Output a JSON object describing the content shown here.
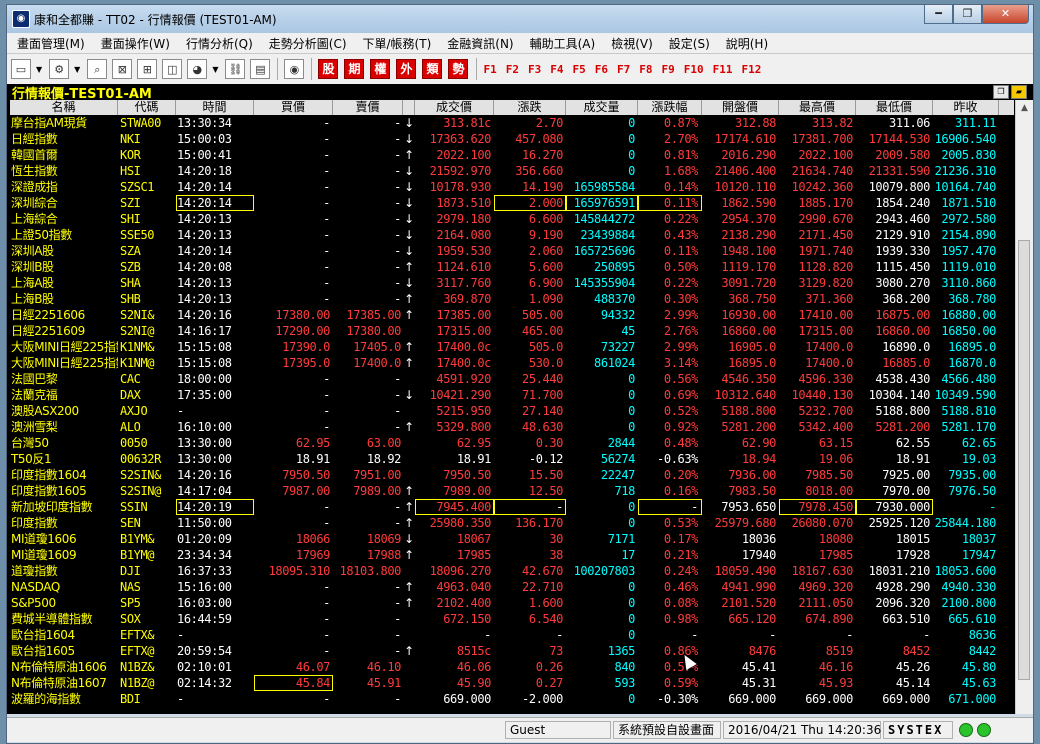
{
  "window": {
    "title": "康和全都賺 - TT02 - 行情報價 (TEST01-AM)",
    "minimize": "━",
    "maximize": "❐",
    "close": "✕"
  },
  "menu": [
    "畫面管理(M)",
    "畫面操作(W)",
    "行情分析(Q)",
    "走勢分析圖(C)",
    "下單/帳務(T)",
    "金融資訊(N)",
    "輔助工具(A)",
    "檢視(V)",
    "設定(S)",
    "說明(H)"
  ],
  "toolbar": {
    "icons": [
      "window-icon",
      "gear-icon",
      "search-icon",
      "close-box-icon",
      "grid-icon",
      "layout-icon",
      "palette-icon",
      "link-icon",
      "chart-icon",
      "logo-icon"
    ],
    "red_buttons": [
      "股",
      "期",
      "權",
      "外",
      "類",
      "勢"
    ],
    "fkeys": [
      "F1",
      "F2",
      "F3",
      "F4",
      "F5",
      "F6",
      "F7",
      "F8",
      "F9",
      "F10",
      "F11",
      "F12"
    ]
  },
  "panel": {
    "title": "行情報價-TEST01-AM"
  },
  "columns": [
    "名稱",
    "代碼",
    "時間",
    "買價",
    "賣價",
    "",
    "成交價",
    "漲跌",
    "成交量",
    "漲跌幅",
    "開盤價",
    "最高價",
    "最低價",
    "昨收"
  ],
  "rows": [
    {
      "name": "摩台指AM現貨",
      "code": "STWA00",
      "time": "13:30:34",
      "bid": "-",
      "ask": "-",
      "arr": "↓",
      "last": "313.81c",
      "chg": "2.70",
      "vol": "0",
      "pct": "0.87%",
      "open": "312.88",
      "high": "313.82",
      "low": "311.06",
      "prev": "311.11"
    },
    {
      "name": "日經指數",
      "code": "NKI",
      "time": "15:00:03",
      "bid": "-",
      "ask": "-",
      "arr": "↓",
      "last": "17363.620",
      "chg": "457.080",
      "vol": "0",
      "pct": "2.70%",
      "open": "17174.610",
      "high": "17381.700",
      "low": "17144.530",
      "prev": "16906.540"
    },
    {
      "name": "韓國首爾",
      "code": "KOR",
      "time": "15:00:41",
      "bid": "-",
      "ask": "-",
      "arr": "↑",
      "last": "2022.100",
      "chg": "16.270",
      "vol": "0",
      "pct": "0.81%",
      "open": "2016.290",
      "high": "2022.100",
      "low": "2009.580",
      "prev": "2005.830"
    },
    {
      "name": "恆生指數",
      "code": "HSI",
      "time": "14:20:18",
      "bid": "-",
      "ask": "-",
      "arr": "↓",
      "last": "21592.970",
      "chg": "356.660",
      "vol": "0",
      "pct": "1.68%",
      "open": "21406.400",
      "high": "21634.740",
      "low": "21331.590",
      "prev": "21236.310"
    },
    {
      "name": "深證成指",
      "code": "SZSC1",
      "time": "14:20:14",
      "bid": "-",
      "ask": "-",
      "arr": "↓",
      "last": "10178.930",
      "chg": "14.190",
      "vol": "165985584",
      "pct": "0.14%",
      "open": "10120.110",
      "high": "10242.360",
      "low": "10079.800",
      "prev": "10164.740"
    },
    {
      "name": "深圳綜合",
      "code": "SZI",
      "time": "14:20:14",
      "bid": "-",
      "ask": "-",
      "arr": "↓",
      "last": "1873.510",
      "chg": "2.000",
      "vol": "165976591",
      "pct": "0.11%",
      "open": "1862.590",
      "high": "1885.170",
      "low": "1854.240",
      "prev": "1871.510"
    },
    {
      "name": "上海綜合",
      "code": "SHI",
      "time": "14:20:13",
      "bid": "-",
      "ask": "-",
      "arr": "↓",
      "last": "2979.180",
      "chg": "6.600",
      "vol": "145844272",
      "pct": "0.22%",
      "open": "2954.370",
      "high": "2990.670",
      "low": "2943.460",
      "prev": "2972.580"
    },
    {
      "name": "上證50指數",
      "code": "SSE50",
      "time": "14:20:13",
      "bid": "-",
      "ask": "-",
      "arr": "↓",
      "last": "2164.080",
      "chg": "9.190",
      "vol": "23439884",
      "pct": "0.43%",
      "open": "2138.290",
      "high": "2171.450",
      "low": "2129.910",
      "prev": "2154.890"
    },
    {
      "name": "深圳A股",
      "code": "SZA",
      "time": "14:20:14",
      "bid": "-",
      "ask": "-",
      "arr": "↓",
      "last": "1959.530",
      "chg": "2.060",
      "vol": "165725696",
      "pct": "0.11%",
      "open": "1948.100",
      "high": "1971.740",
      "low": "1939.330",
      "prev": "1957.470"
    },
    {
      "name": "深圳B股",
      "code": "SZB",
      "time": "14:20:08",
      "bid": "-",
      "ask": "-",
      "arr": "↑",
      "last": "1124.610",
      "chg": "5.600",
      "vol": "250895",
      "pct": "0.50%",
      "open": "1119.170",
      "high": "1128.820",
      "low": "1115.450",
      "prev": "1119.010"
    },
    {
      "name": "上海A股",
      "code": "SHA",
      "time": "14:20:13",
      "bid": "-",
      "ask": "-",
      "arr": "↓",
      "last": "3117.760",
      "chg": "6.900",
      "vol": "145355904",
      "pct": "0.22%",
      "open": "3091.720",
      "high": "3129.820",
      "low": "3080.270",
      "prev": "3110.860"
    },
    {
      "name": "上海B股",
      "code": "SHB",
      "time": "14:20:13",
      "bid": "-",
      "ask": "-",
      "arr": "↑",
      "last": "369.870",
      "chg": "1.090",
      "vol": "488370",
      "pct": "0.30%",
      "open": "368.750",
      "high": "371.360",
      "low": "368.200",
      "prev": "368.780"
    },
    {
      "name": "日經2251606",
      "code": "S2NI&",
      "time": "14:20:16",
      "bid": "17380.00",
      "ask": "17385.00",
      "arr": "↑",
      "last": "17385.00",
      "chg": "505.00",
      "vol": "94332",
      "pct": "2.99%",
      "open": "16930.00",
      "high": "17410.00",
      "low": "16875.00",
      "prev": "16880.00"
    },
    {
      "name": "日經2251609",
      "code": "S2NI@",
      "time": "14:16:17",
      "bid": "17290.00",
      "ask": "17380.00",
      "arr": "",
      "last": "17315.00",
      "chg": "465.00",
      "vol": "45",
      "pct": "2.76%",
      "open": "16860.00",
      "high": "17315.00",
      "low": "16860.00",
      "prev": "16850.00"
    },
    {
      "name": "大阪MINI日經225指數",
      "code": "K1NM&",
      "time": "15:15:08",
      "bid": "17390.0",
      "ask": "17405.0",
      "arr": "↑",
      "last": "17400.0c",
      "chg": "505.0",
      "vol": "73227",
      "pct": "2.99%",
      "open": "16905.0",
      "high": "17400.0",
      "low": "16890.0",
      "prev": "16895.0"
    },
    {
      "name": "大阪MINI日經225指數",
      "code": "K1NM@",
      "time": "15:15:08",
      "bid": "17395.0",
      "ask": "17400.0",
      "arr": "↑",
      "last": "17400.0c",
      "chg": "530.0",
      "vol": "861024",
      "pct": "3.14%",
      "open": "16895.0",
      "high": "17400.0",
      "low": "16885.0",
      "prev": "16870.0"
    },
    {
      "name": "法國巴黎",
      "code": "CAC",
      "time": "18:00:00",
      "bid": "-",
      "ask": "-",
      "arr": "",
      "last": "4591.920",
      "chg": "25.440",
      "vol": "0",
      "pct": "0.56%",
      "open": "4546.350",
      "high": "4596.330",
      "low": "4538.430",
      "prev": "4566.480"
    },
    {
      "name": "法蘭克福",
      "code": "DAX",
      "time": "17:35:00",
      "bid": "-",
      "ask": "-",
      "arr": "↓",
      "last": "10421.290",
      "chg": "71.700",
      "vol": "0",
      "pct": "0.69%",
      "open": "10312.640",
      "high": "10440.130",
      "low": "10304.140",
      "prev": "10349.590"
    },
    {
      "name": "澳股ASX200",
      "code": "AXJO",
      "time": "-",
      "bid": "-",
      "ask": "-",
      "arr": "",
      "last": "5215.950",
      "chg": "27.140",
      "vol": "0",
      "pct": "0.52%",
      "open": "5188.800",
      "high": "5232.700",
      "low": "5188.800",
      "prev": "5188.810"
    },
    {
      "name": "澳洲雪梨",
      "code": "ALO",
      "time": "16:10:00",
      "bid": "-",
      "ask": "-",
      "arr": "↑",
      "last": "5329.800",
      "chg": "48.630",
      "vol": "0",
      "pct": "0.92%",
      "open": "5281.200",
      "high": "5342.400",
      "low": "5281.200",
      "prev": "5281.170"
    },
    {
      "name": "台灣50",
      "code": "0050",
      "time": "13:30:00",
      "bid": "62.95",
      "ask": "63.00",
      "arr": "",
      "last": "62.95",
      "chg": "0.30",
      "vol": "2844",
      "pct": "0.48%",
      "open": "62.90",
      "high": "63.15",
      "low": "62.55",
      "prev": "62.65"
    },
    {
      "name": "T50反1",
      "code": "00632R",
      "time": "13:30:00",
      "bid": "18.91",
      "ask": "18.92",
      "arr": "",
      "last": "18.91",
      "chg": "-0.12",
      "vol": "56274",
      "pct": "-0.63%",
      "open": "18.94",
      "high": "19.06",
      "low": "18.91",
      "prev": "19.03"
    },
    {
      "name": "印度指數1604",
      "code": "S2SIN&",
      "time": "14:20:16",
      "bid": "7950.50",
      "ask": "7951.00",
      "arr": "",
      "last": "7950.50",
      "chg": "15.50",
      "vol": "22247",
      "pct": "0.20%",
      "open": "7936.00",
      "high": "7985.50",
      "low": "7925.00",
      "prev": "7935.00"
    },
    {
      "name": "印度指數1605",
      "code": "S2SIN@",
      "time": "14:17:04",
      "bid": "7987.00",
      "ask": "7989.00",
      "arr": "↑",
      "last": "7989.00",
      "chg": "12.50",
      "vol": "718",
      "pct": "0.16%",
      "open": "7983.50",
      "high": "8018.00",
      "low": "7970.00",
      "prev": "7976.50"
    },
    {
      "name": "新加坡印度指數",
      "code": "SSIN",
      "time": "14:20:19",
      "bid": "-",
      "ask": "-",
      "arr": "↑",
      "last": "7945.400",
      "chg": "-",
      "vol": "0",
      "pct": "-",
      "open": "7953.650",
      "high": "7978.450",
      "low": "7930.000",
      "prev": "-"
    },
    {
      "name": "印度指數",
      "code": "SEN",
      "time": "11:50:00",
      "bid": "-",
      "ask": "-",
      "arr": "↑",
      "last": "25980.350",
      "chg": "136.170",
      "vol": "0",
      "pct": "0.53%",
      "open": "25979.680",
      "high": "26080.070",
      "low": "25925.120",
      "prev": "25844.180"
    },
    {
      "name": "MI道瓊1606",
      "code": "B1YM&",
      "time": "01:20:09",
      "bid": "18066",
      "ask": "18069",
      "arr": "↓",
      "last": "18067",
      "chg": "30",
      "vol": "7171",
      "pct": "0.17%",
      "open": "18036",
      "high": "18080",
      "low": "18015",
      "prev": "18037"
    },
    {
      "name": "MI道瓊1609",
      "code": "B1YM@",
      "time": "23:34:34",
      "bid": "17969",
      "ask": "17988",
      "arr": "↑",
      "last": "17985",
      "chg": "38",
      "vol": "17",
      "pct": "0.21%",
      "open": "17940",
      "high": "17985",
      "low": "17928",
      "prev": "17947"
    },
    {
      "name": "道瓊指數",
      "code": "DJI",
      "time": "16:37:33",
      "bid": "18095.310",
      "ask": "18103.800",
      "arr": "",
      "last": "18096.270",
      "chg": "42.670",
      "vol": "100207803",
      "pct": "0.24%",
      "open": "18059.490",
      "high": "18167.630",
      "low": "18031.210",
      "prev": "18053.600"
    },
    {
      "name": "NASDAQ",
      "code": "NAS",
      "time": "15:16:00",
      "bid": "-",
      "ask": "-",
      "arr": "↑",
      "last": "4963.040",
      "chg": "22.710",
      "vol": "0",
      "pct": "0.46%",
      "open": "4941.990",
      "high": "4969.320",
      "low": "4928.290",
      "prev": "4940.330"
    },
    {
      "name": "S&P500",
      "code": "SP5",
      "time": "16:03:00",
      "bid": "-",
      "ask": "-",
      "arr": "↑",
      "last": "2102.400",
      "chg": "1.600",
      "vol": "0",
      "pct": "0.08%",
      "open": "2101.520",
      "high": "2111.050",
      "low": "2096.320",
      "prev": "2100.800"
    },
    {
      "name": "費城半導體指數",
      "code": "SOX",
      "time": "16:44:59",
      "bid": "-",
      "ask": "-",
      "arr": "",
      "last": "672.150",
      "chg": "6.540",
      "vol": "0",
      "pct": "0.98%",
      "open": "665.120",
      "high": "674.890",
      "low": "663.510",
      "prev": "665.610"
    },
    {
      "name": "歐台指1604",
      "code": "EFTX&",
      "time": "-",
      "bid": "-",
      "ask": "-",
      "arr": "",
      "last": "-",
      "chg": "-",
      "vol": "0",
      "pct": "-",
      "open": "-",
      "high": "-",
      "low": "-",
      "prev": "8636"
    },
    {
      "name": "歐台指1605",
      "code": "EFTX@",
      "time": "20:59:54",
      "bid": "-",
      "ask": "-",
      "arr": "↑",
      "last": "8515c",
      "chg": "73",
      "vol": "1365",
      "pct": "0.86%",
      "open": "8476",
      "high": "8519",
      "low": "8452",
      "prev": "8442"
    },
    {
      "name": "N布倫特原油1606",
      "code": "N1BZ&",
      "time": "02:10:01",
      "bid": "46.07",
      "ask": "46.10",
      "arr": "",
      "last": "46.06",
      "chg": "0.26",
      "vol": "840",
      "pct": "0.57%",
      "open": "45.41",
      "high": "46.16",
      "low": "45.26",
      "prev": "45.80"
    },
    {
      "name": "N布倫特原油1607",
      "code": "N1BZ@",
      "time": "02:14:32",
      "bid": "45.84",
      "ask": "45.91",
      "arr": "",
      "last": "45.90",
      "chg": "0.27",
      "vol": "593",
      "pct": "0.59%",
      "open": "45.31",
      "high": "45.93",
      "low": "45.14",
      "prev": "45.63"
    },
    {
      "name": "波羅的海指數",
      "code": "BDI",
      "time": "-",
      "bid": "-",
      "ask": "-",
      "arr": "",
      "last": "669.000",
      "chg": "-2.000",
      "vol": "0",
      "pct": "-0.30%",
      "open": "669.000",
      "high": "669.000",
      "low": "669.000",
      "prev": "671.000"
    }
  ],
  "status": {
    "user": "Guest",
    "layout": "系統預設自設畫面",
    "datetime": "2016/04/21 Thu 14:20:36",
    "brand": "SYSTEX"
  },
  "colors": {
    "up": "#ff3b3b",
    "flat": "#ffffff",
    "volume": "#00ffff",
    "label": "#ffff00",
    "background": "#000000"
  }
}
